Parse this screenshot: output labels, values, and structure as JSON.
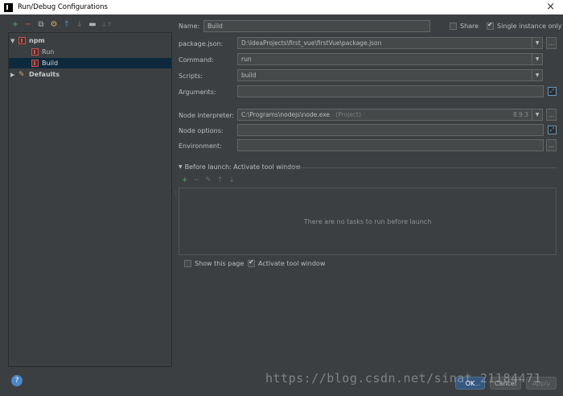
{
  "window": {
    "title": "Run/Debug Configurations",
    "close_icon": "×"
  },
  "toolbar": [
    "+",
    "−",
    "⧉",
    "⚙",
    "↑",
    "↓",
    "▬",
    "↓↑"
  ],
  "tree": {
    "npm": "npm",
    "run": "Run",
    "build": "Build",
    "defaults": "Defaults"
  },
  "form": {
    "name_label": "Name:",
    "name_value": "Build",
    "share_label": "Share",
    "single_instance_label": "Single instance only",
    "package_json_label": "package.json:",
    "package_json_value": "D:\\IdeaProjects\\first_vue\\firstVue\\package.json",
    "command_label": "Command:",
    "command_value": "run",
    "scripts_label": "Scripts:",
    "scripts_value": "build",
    "arguments_label": "Arguments:",
    "arguments_value": "",
    "node_interpreter_label": "Node interpreter:",
    "node_interpreter_value": "C:\\Programs\\nodejs\\node.exe",
    "node_interpreter_suffix": "(Project)",
    "node_version": "8.9.3",
    "node_options_label": "Node options:",
    "node_options_value": "",
    "environment_label": "Environment:",
    "environment_value": ""
  },
  "before_launch": {
    "title": "Before launch: Activate tool window",
    "empty_text": "There are no tasks to run before launch",
    "show_page_label": "Show this page",
    "activate_label": "Activate tool window"
  },
  "buttons": {
    "ok": "OK",
    "cancel": "Cancel",
    "apply": "Apply",
    "dots": "...",
    "help": "?"
  },
  "watermark": "https://blog.csdn.net/sinat_21184471",
  "checks": {
    "share": false,
    "single_instance": true,
    "show_page": false,
    "activate_tool": true
  }
}
